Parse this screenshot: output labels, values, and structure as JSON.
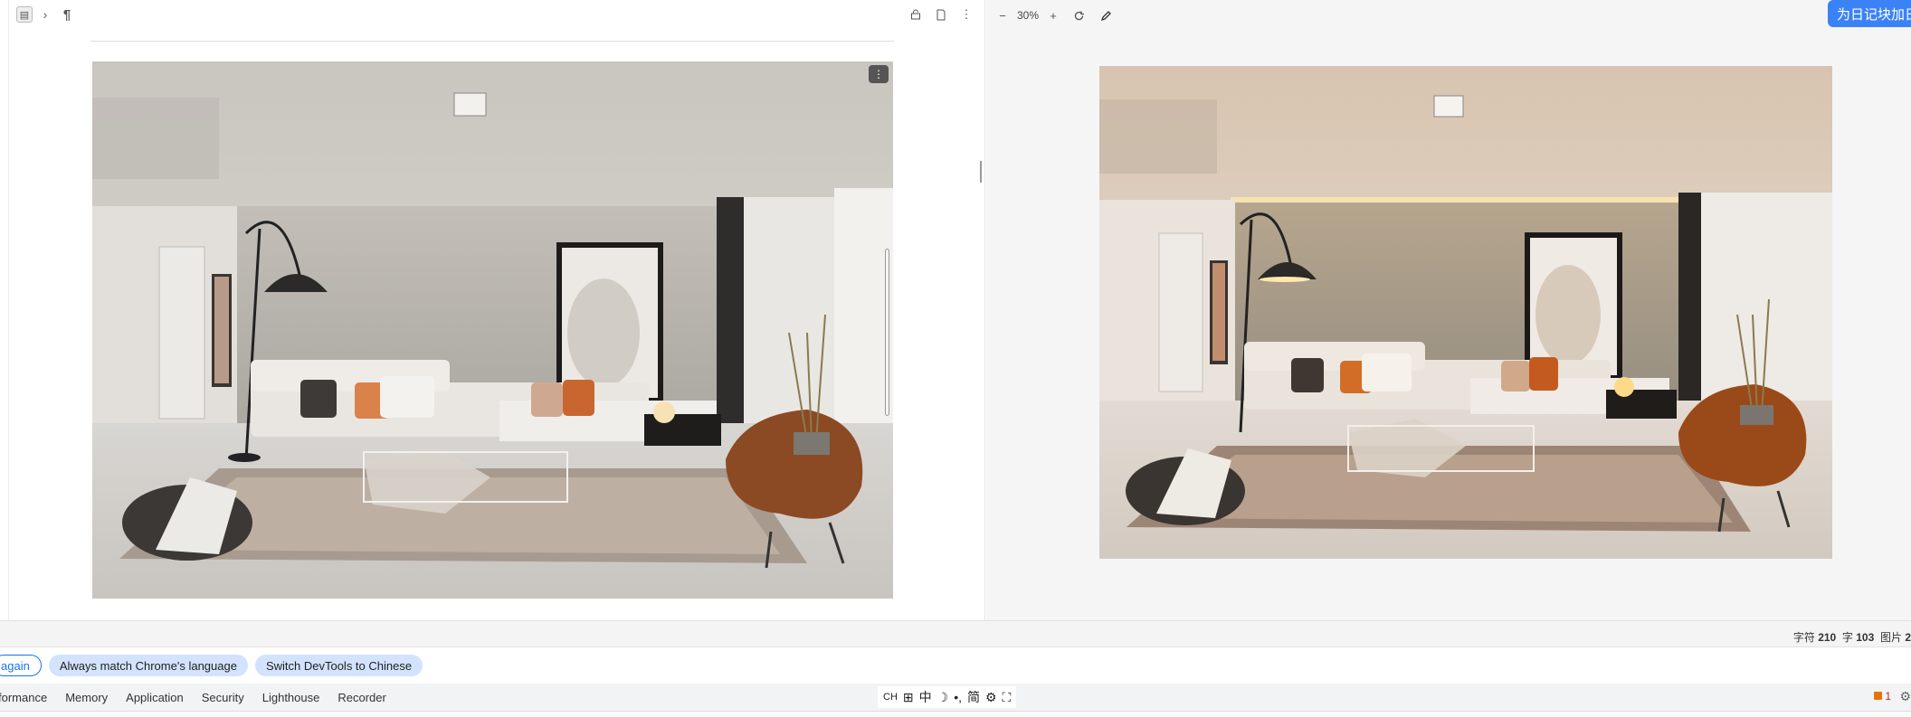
{
  "left_toolbar": {
    "doc_icon": "document-icon",
    "separator": "›",
    "paragraph_mark": "¶",
    "right_icons": [
      "lock-icon",
      "page-icon",
      "more-vert-icon"
    ]
  },
  "right_toolbar": {
    "zoom_out": "−",
    "zoom_value": "30%",
    "zoom_in": "+",
    "rotate_icon": "rotate-icon",
    "edit_icon": "pencil-icon"
  },
  "journal_button": "为日记块加日",
  "status": {
    "chars_label": "字符",
    "chars_value": "210",
    "words_label": "字",
    "words_value": "103",
    "images_label": "图片",
    "images_value": "2"
  },
  "lang_bar": {
    "again_label": "again",
    "match_label": "Always match Chrome's language",
    "switch_label": "Switch DevTools to Chinese"
  },
  "devtools_tabs": [
    "formance",
    "Memory",
    "Application",
    "Security",
    "Lighthouse",
    "Recorder"
  ],
  "ime": [
    "CH",
    "⊞",
    "中",
    "☽",
    "•,",
    "简",
    "⚙",
    "⛶"
  ],
  "issues_count": "1",
  "colors": {
    "accent": "#1a73e8",
    "chip_bg": "#d3e3fd",
    "journal_btn": "#3b82f6"
  }
}
